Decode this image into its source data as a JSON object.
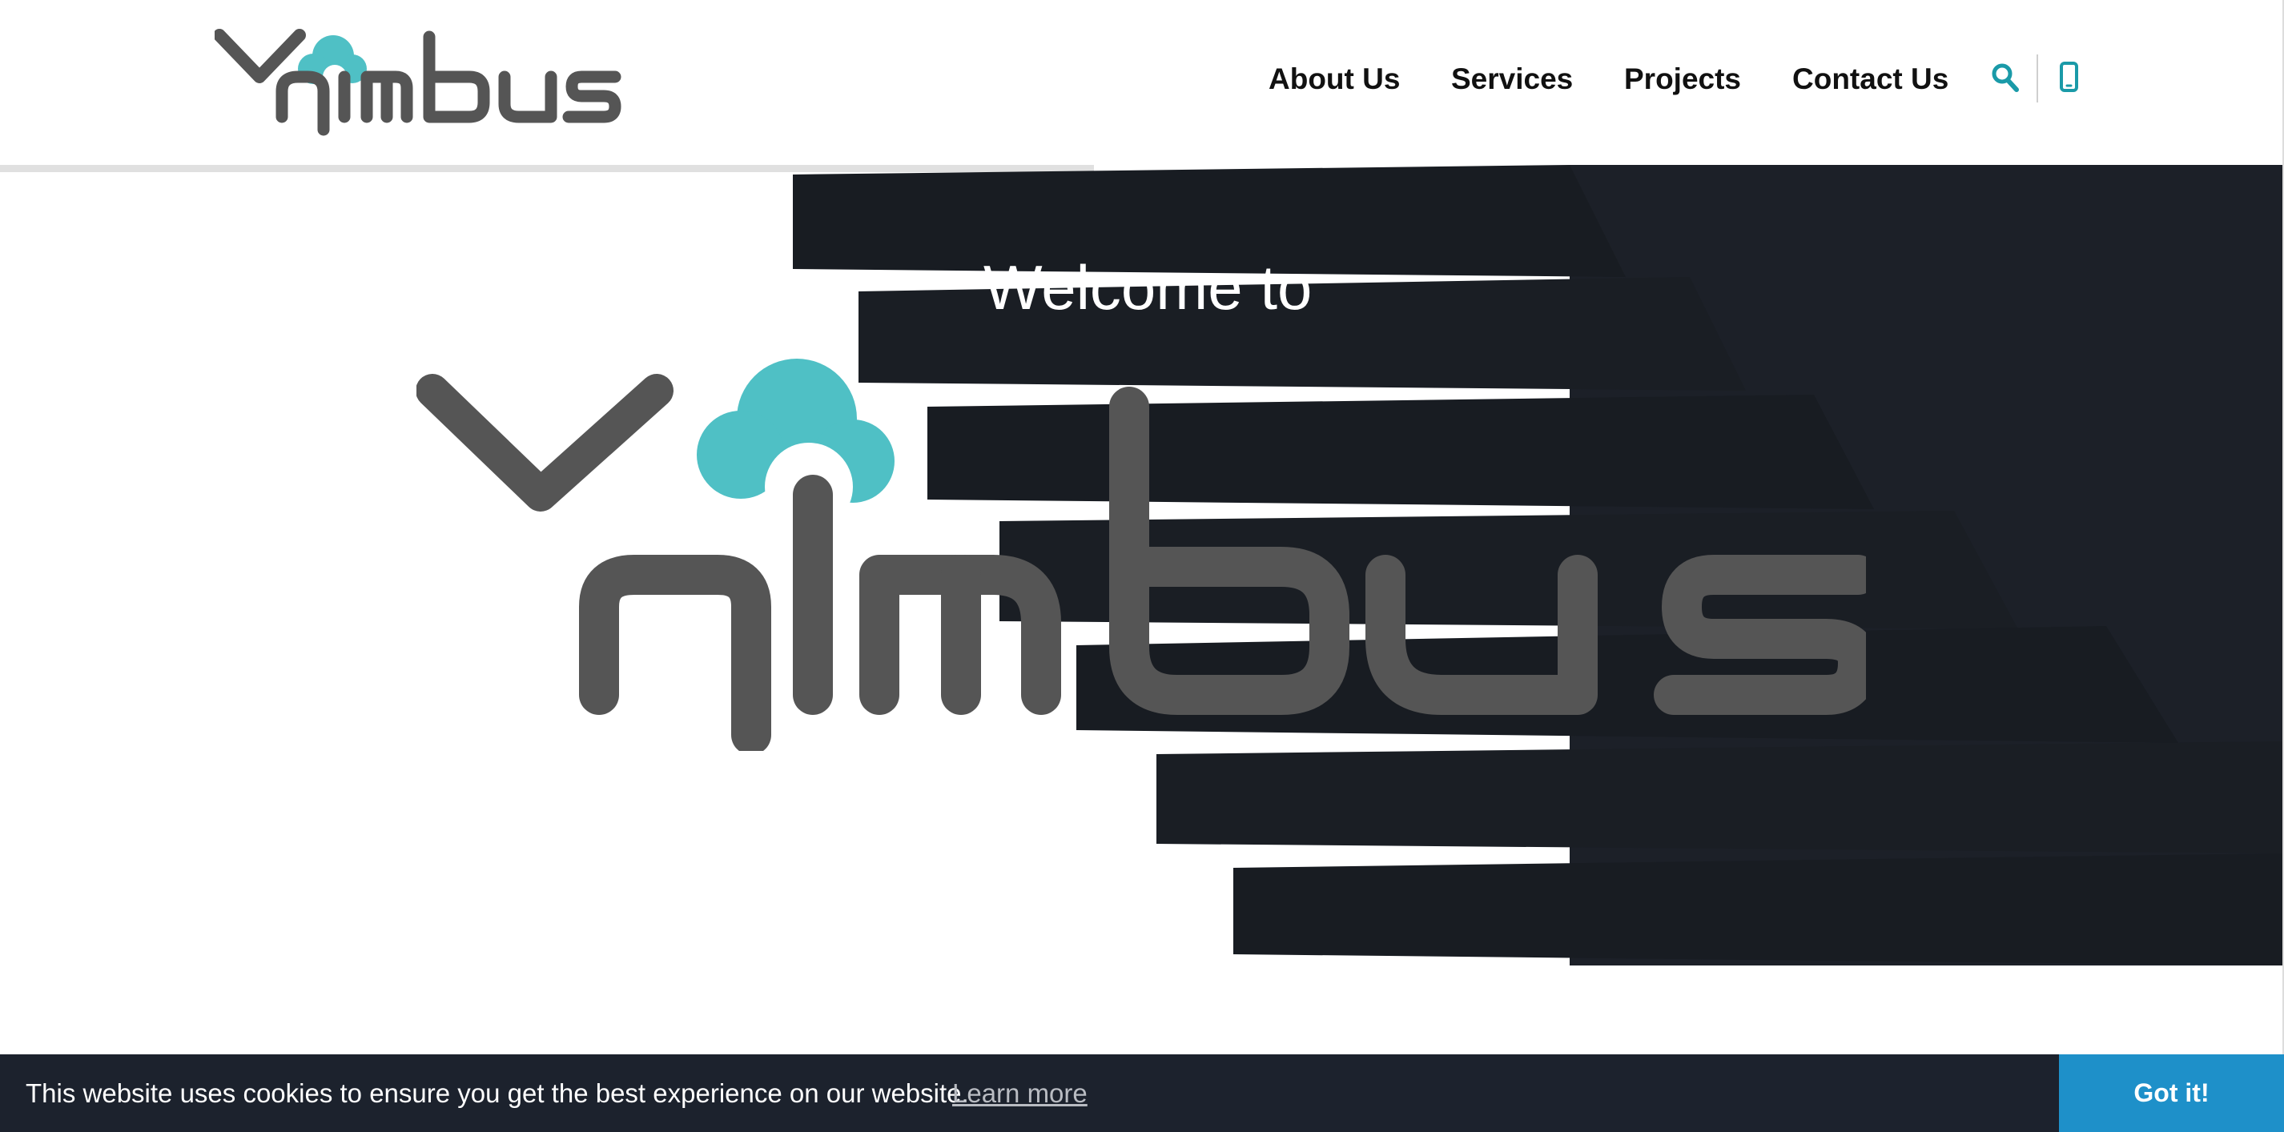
{
  "header": {
    "logo_alt": "Vnimbus",
    "nav": [
      {
        "label": "About Us"
      },
      {
        "label": "Services"
      },
      {
        "label": "Projects"
      },
      {
        "label": "Contact Us"
      }
    ],
    "icons": [
      "search-icon",
      "phone-icon"
    ]
  },
  "hero": {
    "welcome": "Welcome to",
    "logo_alt": "Vnimbus"
  },
  "cookie": {
    "message": "This website uses cookies to ensure you get the best experience on our website.",
    "learn_more": "Learn more",
    "button": "Got it!"
  },
  "colors": {
    "brand_teal": "#4fc0c5",
    "logo_gray": "#555555",
    "hero_dark": "#181c22",
    "cookie_bar": "#1c222d",
    "cookie_button": "#1e90c9",
    "icon_teal": "#1a9aa8"
  }
}
